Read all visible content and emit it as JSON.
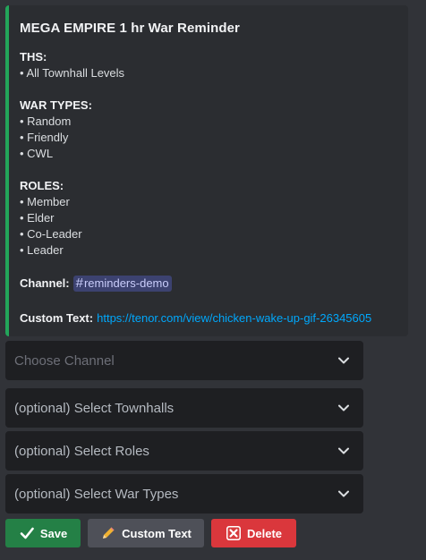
{
  "embed": {
    "title": "MEGA EMPIRE 1 hr War Reminder",
    "accent_color": "#23a55a",
    "ths": {
      "name": "THS:",
      "items": [
        "• All Townhall Levels"
      ]
    },
    "war_types": {
      "name": "WAR TYPES:",
      "items": [
        "• Random",
        "• Friendly",
        "• CWL"
      ]
    },
    "roles": {
      "name": "ROLES:",
      "items": [
        "• Member",
        "• Elder",
        "• Co-Leader",
        "• Leader"
      ]
    },
    "channel": {
      "label": "Channel:",
      "mention_icon": "#",
      "mention": "reminders-demo"
    },
    "custom_text": {
      "label": "Custom Text:",
      "link": "https://tenor.com/view/chicken-wake-up-gif-26345605"
    }
  },
  "selects": {
    "channel": {
      "placeholder": "Choose Channel",
      "icon": "chevron-down-icon"
    },
    "townhalls": {
      "placeholder": "(optional) Select Townhalls",
      "icon": "chevron-down-icon"
    },
    "roles": {
      "placeholder": "(optional) Select Roles",
      "icon": "chevron-down-icon"
    },
    "war_types": {
      "placeholder": "(optional) Select War Types",
      "icon": "chevron-down-icon"
    }
  },
  "buttons": {
    "save": {
      "label": "Save",
      "icon": "check-mark-icon",
      "color": "#248046"
    },
    "custom_text": {
      "label": "Custom Text",
      "icon": "pencil-icon",
      "color": "#4e5058"
    },
    "delete": {
      "label": "Delete",
      "icon": "cross-mark-icon",
      "color": "#da373c"
    }
  }
}
